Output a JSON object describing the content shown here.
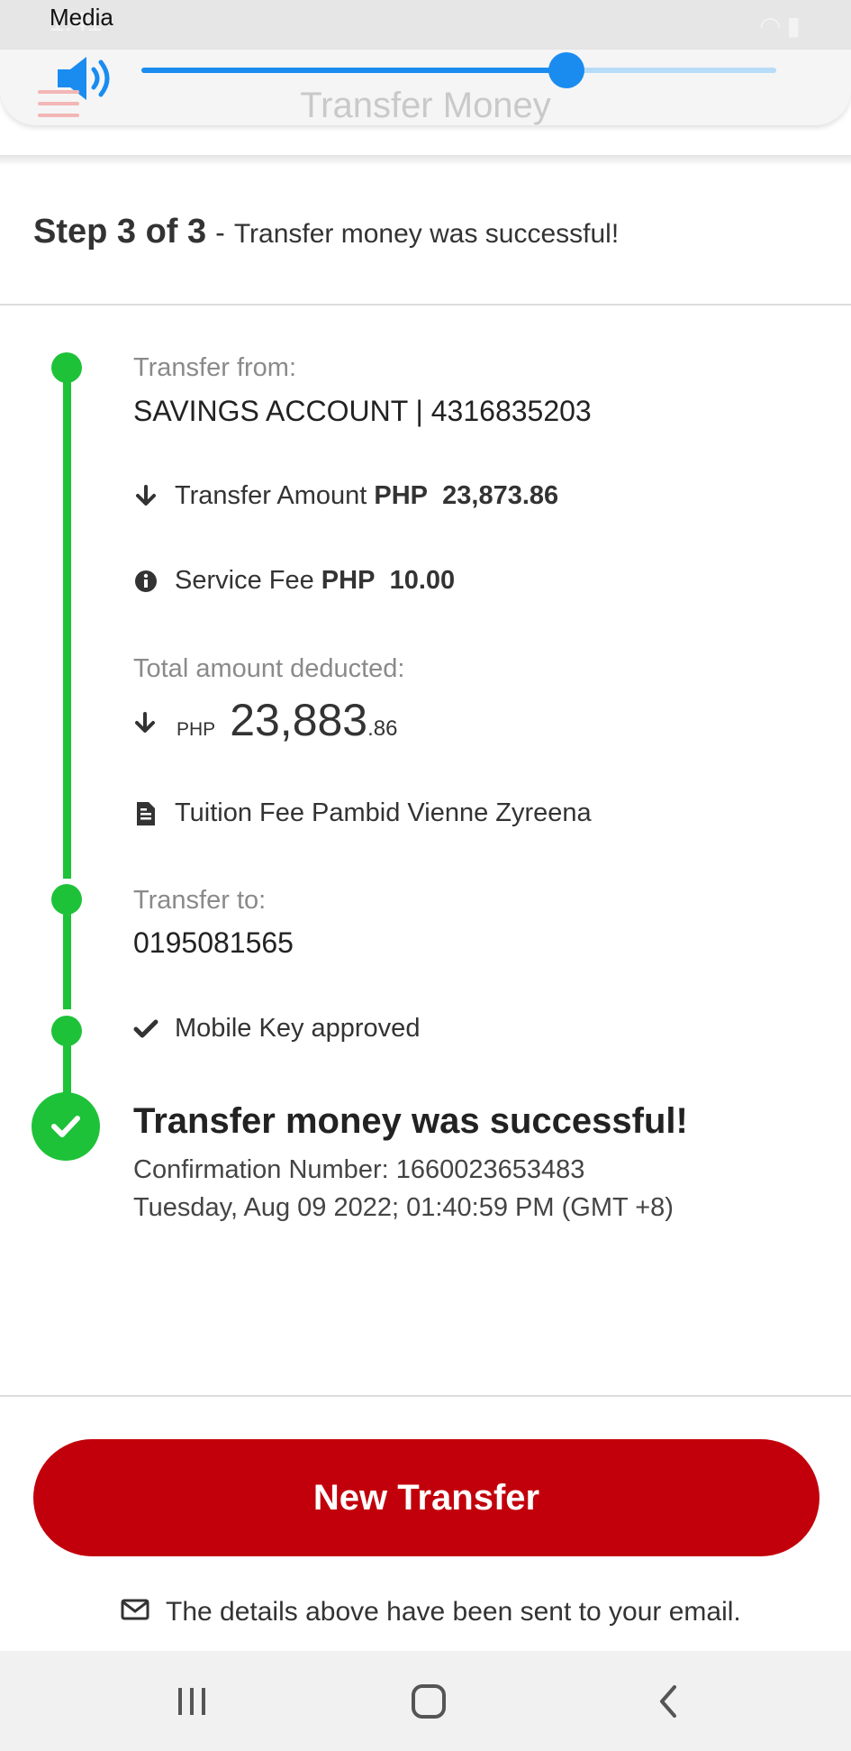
{
  "status_bar": {
    "ghost_time": "1:41",
    "media_label": "Media"
  },
  "volume": {
    "level_percent": 67
  },
  "app_header": {
    "title": "Transfer Money"
  },
  "step": {
    "title": "Step 3 of 3",
    "separator": "-",
    "description": "Transfer money was successful!"
  },
  "transfer_from": {
    "label": "Transfer from:",
    "value": "SAVINGS ACCOUNT | 4316835203"
  },
  "transfer_amount": {
    "label": "Transfer Amount",
    "currency": "PHP",
    "amount": "23,873.86"
  },
  "service_fee": {
    "label": "Service Fee",
    "currency": "PHP",
    "amount": "10.00"
  },
  "total": {
    "label": "Total amount deducted:",
    "currency": "PHP",
    "whole": "23,883",
    "decimal": ".86"
  },
  "remarks": {
    "text": "Tuition Fee Pambid Vienne Zyreena"
  },
  "transfer_to": {
    "label": "Transfer to:",
    "value": "0195081565"
  },
  "mobile_key": {
    "text": "Mobile Key approved"
  },
  "result": {
    "title": "Transfer money was successful!",
    "confirmation": "Confirmation Number: 1660023653483",
    "datetime": "Tuesday, Aug 09 2022; 01:40:59 PM (GMT +8)"
  },
  "actions": {
    "new_transfer_label": "New Transfer"
  },
  "email_note": "The details above have been sent to your email.",
  "colors": {
    "accent_red": "#c2000b",
    "timeline_green": "#1ec238",
    "volume_blue": "#1a8cf0"
  },
  "icons": [
    "volume-icon",
    "arrow-down-icon",
    "info-icon",
    "document-icon",
    "check-icon",
    "success-check-icon",
    "mail-icon",
    "recents-icon",
    "home-icon",
    "back-icon"
  ]
}
